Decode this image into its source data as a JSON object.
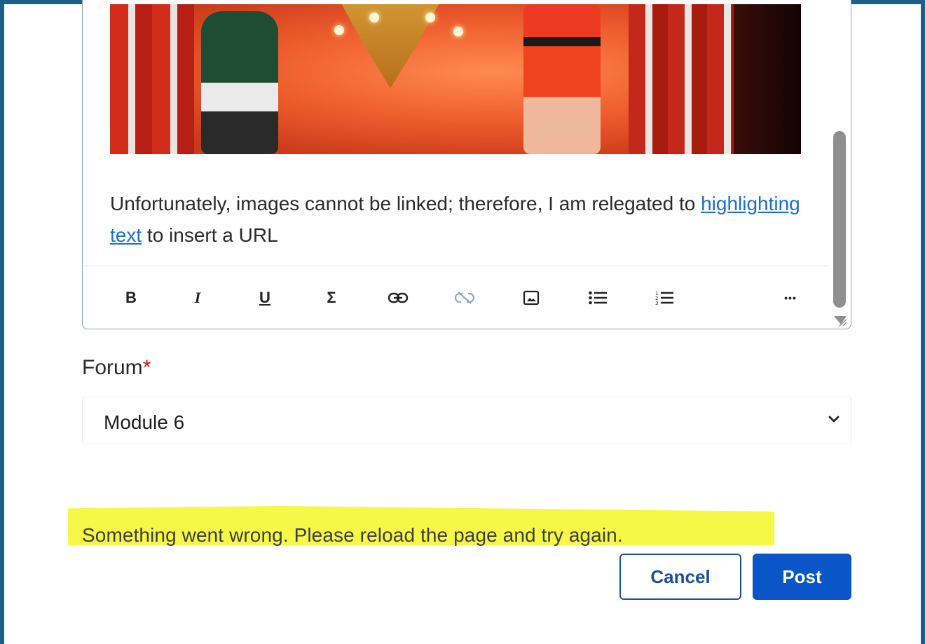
{
  "editor": {
    "image_alt": "Circus performers photo",
    "text_before": "Unfortunately, images cannot be linked; therefore, I am relegated to ",
    "link_text": "highlighting text",
    "text_after": " to insert a URL",
    "toolbar": {
      "bold_label": "B",
      "italic_label": "I",
      "underline_label": "U",
      "equation_label": "Σ",
      "more_label": "•••"
    }
  },
  "forum": {
    "label": "Forum",
    "required_mark": "*",
    "selected": "Module 6"
  },
  "error": {
    "message": "Something went wrong. Please reload the page and try again."
  },
  "actions": {
    "cancel_label": "Cancel",
    "post_label": "Post"
  },
  "colors": {
    "frame_border": "#1d5f86",
    "link": "#1a6fd0",
    "primary": "#0a55c8",
    "required": "#c51616",
    "highlight": "#f6f848"
  }
}
